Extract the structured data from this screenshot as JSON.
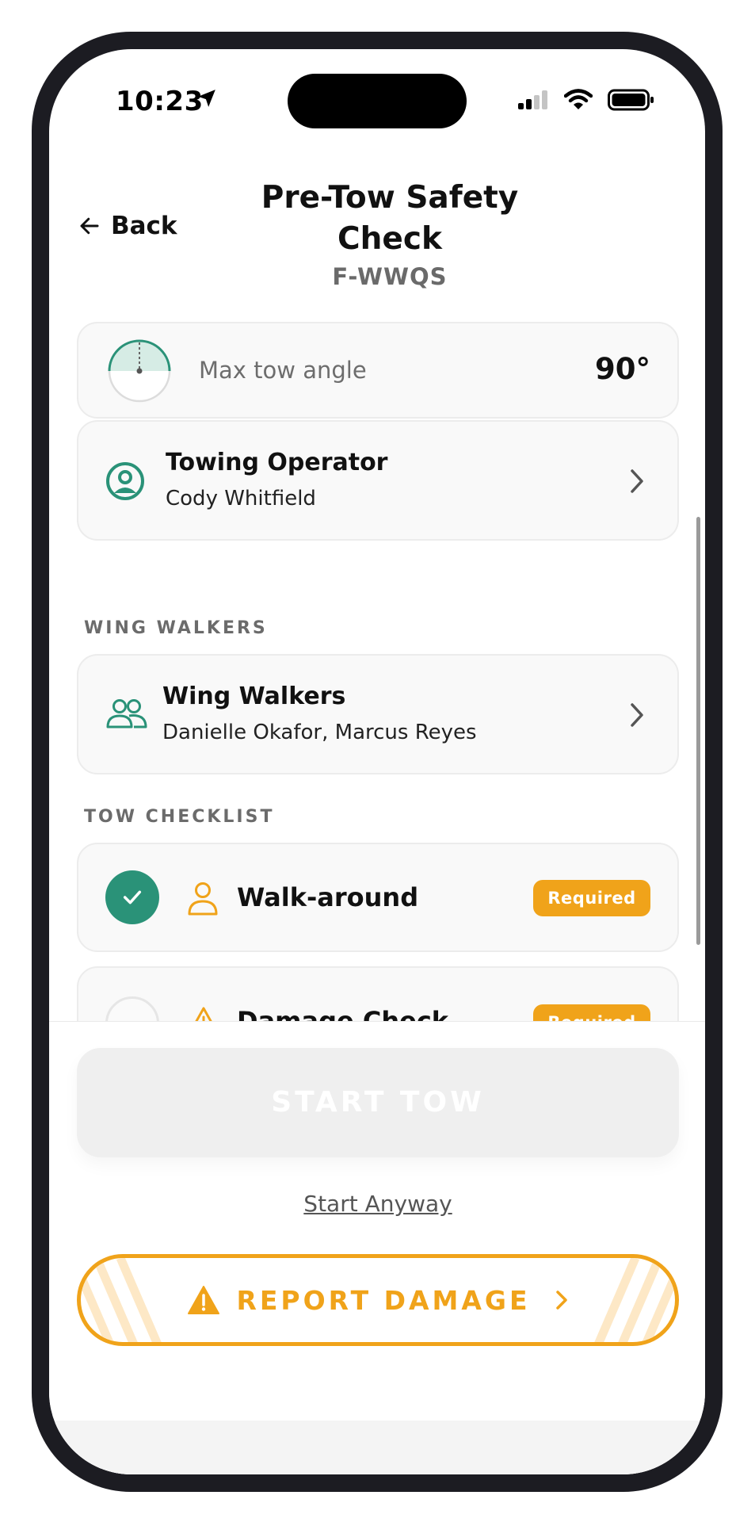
{
  "status_bar": {
    "time": "10:23"
  },
  "header": {
    "back_label": "Back",
    "title": "Pre-Tow Safety Check",
    "subtitle": "F-WWQS"
  },
  "tow_angle": {
    "label": "Max tow angle",
    "value": "90°"
  },
  "operator": {
    "title": "Towing Operator",
    "name": "Cody Whitfield"
  },
  "wing_walkers_section": {
    "label": "WING WALKERS",
    "card_title": "Wing Walkers",
    "names": "Danielle Okafor, Marcus Reyes"
  },
  "checklist_section": {
    "label": "TOW CHECKLIST",
    "items": [
      {
        "title": "Walk-around",
        "badge": "Required",
        "done": true
      },
      {
        "title": "Damage Check",
        "badge": "Required",
        "done": false
      }
    ]
  },
  "actions": {
    "start_tow": "START TOW",
    "start_anyway": "Start Anyway",
    "report_damage": "REPORT DAMAGE"
  },
  "colors": {
    "accent_green": "#2a9278",
    "warning_orange": "#f0a31a"
  },
  "icons": [
    "location-arrow-icon",
    "signal-icon",
    "wifi-icon",
    "battery-icon",
    "back-arrow-icon",
    "tow-angle-gauge-icon",
    "user-circle-icon",
    "chevron-right-icon",
    "users-icon",
    "checkmark-icon",
    "person-icon",
    "warning-triangle-icon"
  ]
}
